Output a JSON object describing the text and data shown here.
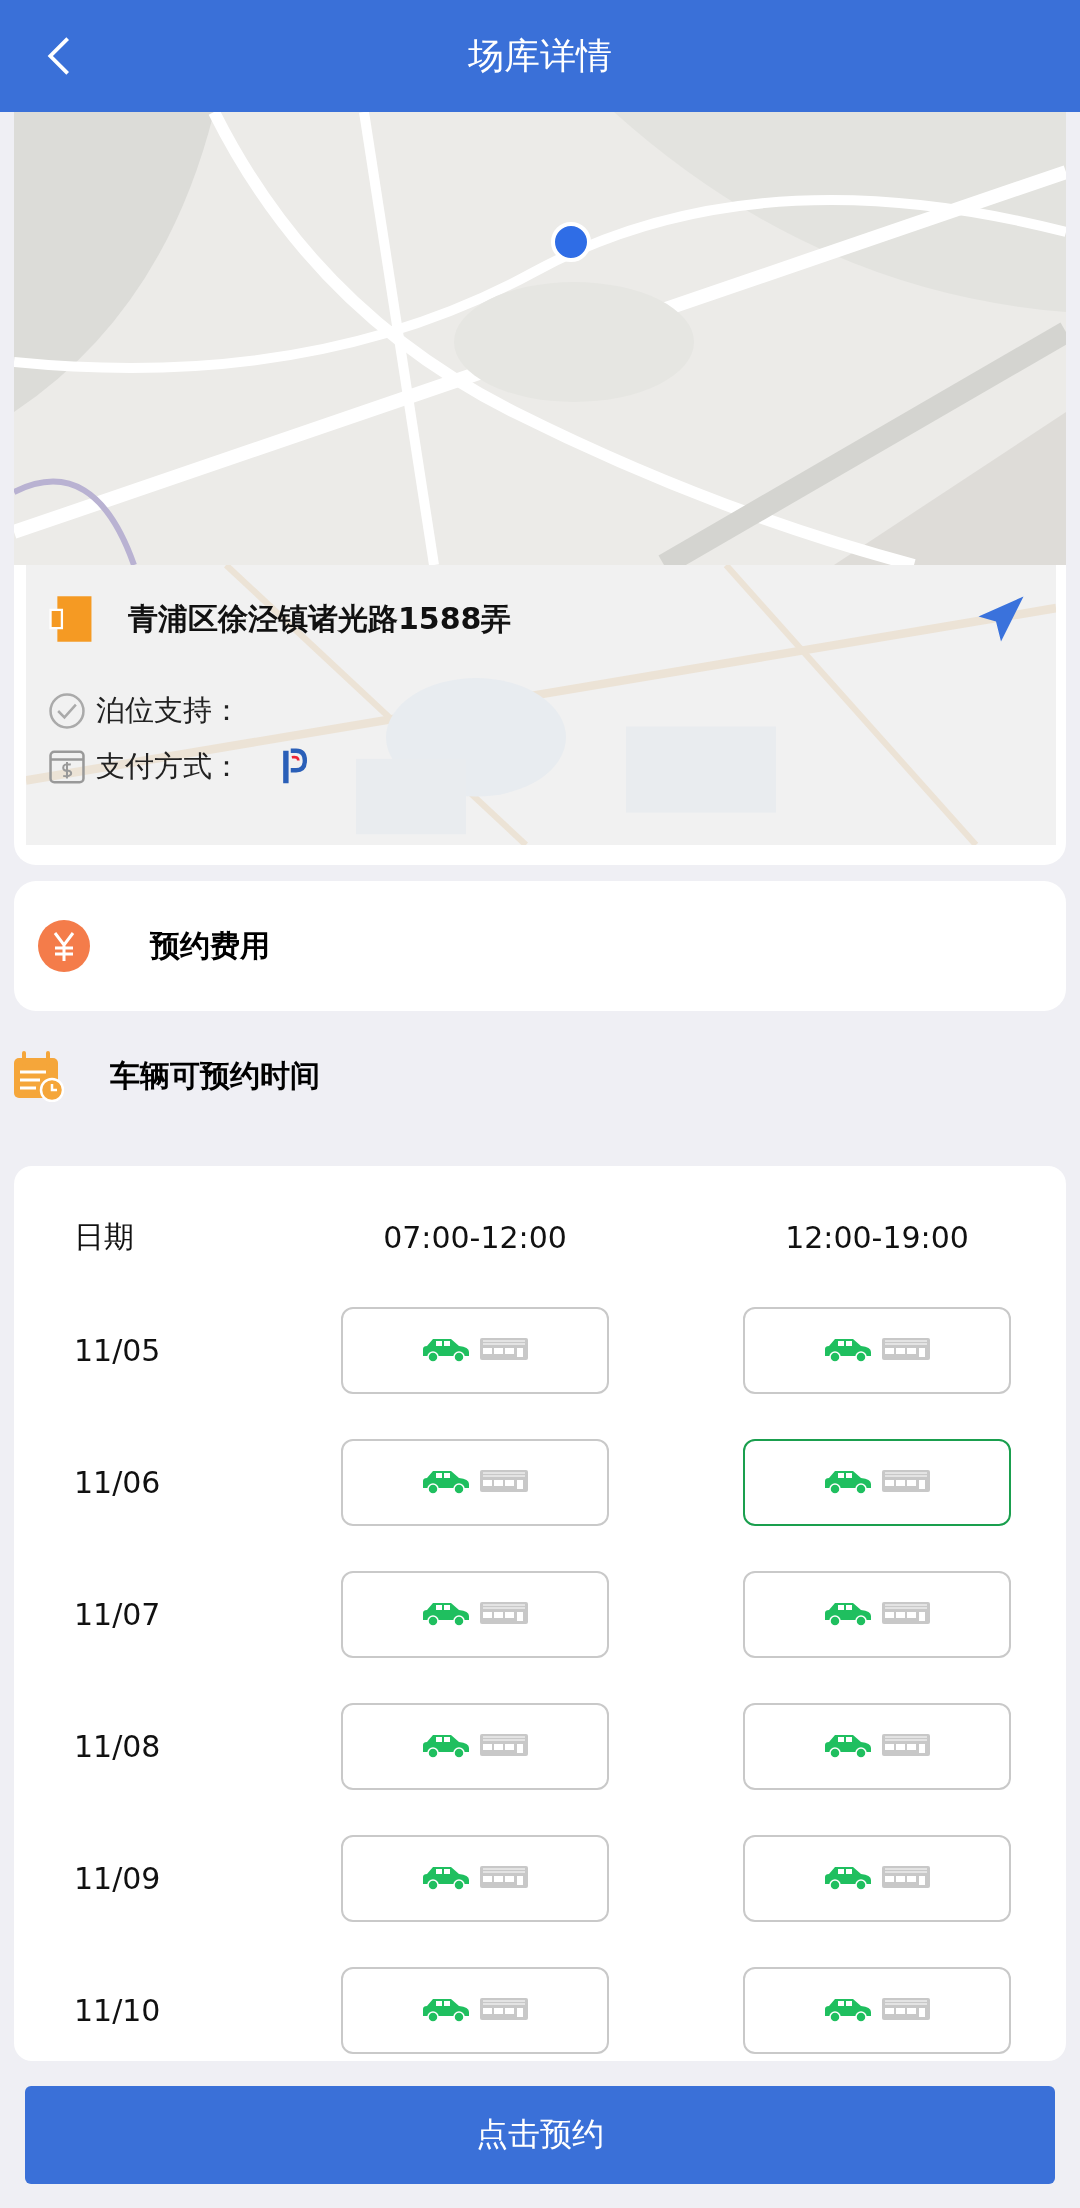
{
  "header": {
    "title": "场库详情"
  },
  "location": {
    "address": "青浦区徐泾镇诸光路1588弄",
    "features": [
      {
        "kind": "berth",
        "label": "泊位支持："
      },
      {
        "kind": "payment",
        "label": "支付方式："
      }
    ]
  },
  "fee": {
    "label": "预约费用"
  },
  "schedule": {
    "title": "车辆可预约时间",
    "columns": [
      "日期",
      "07:00-12:00",
      "12:00-19:00"
    ],
    "rows": [
      {
        "date": "11/05",
        "slots": [
          {
            "selected": false,
            "car_available": true,
            "bus_available": false
          },
          {
            "selected": false,
            "car_available": true,
            "bus_available": false
          }
        ]
      },
      {
        "date": "11/06",
        "slots": [
          {
            "selected": false,
            "car_available": true,
            "bus_available": false
          },
          {
            "selected": true,
            "car_available": true,
            "bus_available": false
          }
        ]
      },
      {
        "date": "11/07",
        "slots": [
          {
            "selected": false,
            "car_available": true,
            "bus_available": false
          },
          {
            "selected": false,
            "car_available": true,
            "bus_available": false
          }
        ]
      },
      {
        "date": "11/08",
        "slots": [
          {
            "selected": false,
            "car_available": true,
            "bus_available": false
          },
          {
            "selected": false,
            "car_available": true,
            "bus_available": false
          }
        ]
      },
      {
        "date": "11/09",
        "slots": [
          {
            "selected": false,
            "car_available": true,
            "bus_available": false
          },
          {
            "selected": false,
            "car_available": true,
            "bus_available": false
          }
        ]
      },
      {
        "date": "11/10",
        "slots": [
          {
            "selected": false,
            "car_available": true,
            "bus_available": false
          },
          {
            "selected": false,
            "car_available": true,
            "bus_available": false
          }
        ]
      }
    ]
  },
  "book_button": "点击预约"
}
